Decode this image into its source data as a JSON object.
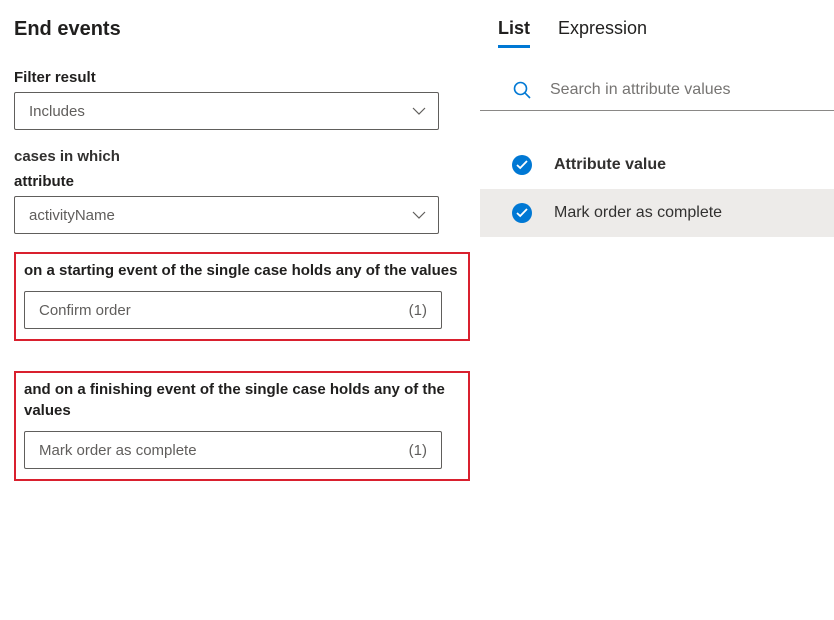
{
  "heading": "End events",
  "filterResult": {
    "label": "Filter result",
    "value": "Includes"
  },
  "casesText": "cases in which",
  "attribute": {
    "label": "attribute",
    "value": "activityName"
  },
  "start": {
    "label": "on a starting event of the single case holds any of the values",
    "value": "Confirm order",
    "count": "(1)"
  },
  "finish": {
    "label": "and on a finishing event of the single case holds any of the values",
    "value": "Mark order as complete",
    "count": "(1)"
  },
  "tabs": {
    "list": "List",
    "expression": "Expression"
  },
  "search": {
    "placeholder": "Search in attribute values"
  },
  "attrHeader": "Attribute value",
  "attrItems": {
    "0": "Mark order as complete"
  }
}
